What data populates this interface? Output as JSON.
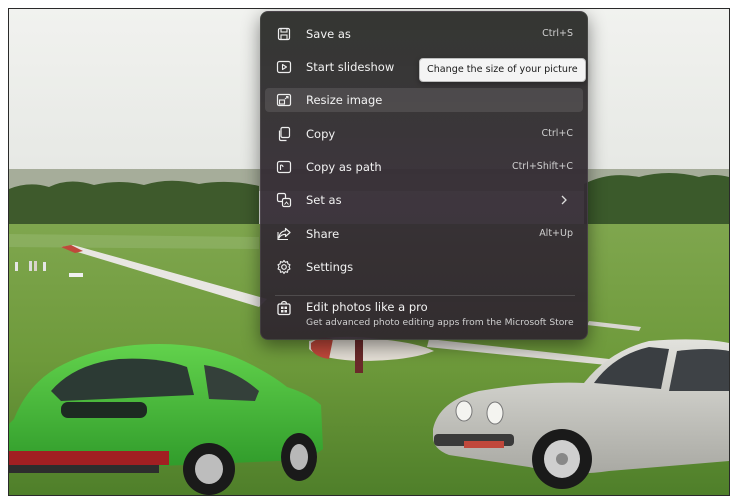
{
  "context_menu": {
    "items": [
      {
        "label": "Save as",
        "shortcut": "Ctrl+S",
        "icon": "save-icon"
      },
      {
        "label": "Start slideshow",
        "shortcut": "",
        "icon": "slideshow-icon"
      },
      {
        "label": "Resize image",
        "shortcut": "",
        "icon": "resize-icon"
      },
      {
        "label": "Copy",
        "shortcut": "Ctrl+C",
        "icon": "copy-icon"
      },
      {
        "label": "Copy as path",
        "shortcut": "Ctrl+Shift+C",
        "icon": "copy-path-icon"
      },
      {
        "label": "Set as",
        "shortcut": "",
        "icon": "set-as-icon",
        "has_submenu": true
      },
      {
        "label": "Share",
        "shortcut": "Alt+Up",
        "icon": "share-icon"
      },
      {
        "label": "Settings",
        "shortcut": "",
        "icon": "settings-icon"
      }
    ],
    "promo": {
      "title": "Edit photos like a pro",
      "subtitle": "Get advanced photo editing apps from the Microsoft Store",
      "icon": "store-icon"
    },
    "highlighted_item": "Resize image"
  },
  "tooltip": {
    "text": "Change the size of your picture"
  },
  "photo": {
    "subject": "two-vintage-cars-on-airfield"
  },
  "colors": {
    "menu_background": "#2f2f2d",
    "menu_text": "#f3f3f3",
    "tooltip_background": "#f4f4f4",
    "green_car": "#4cc23c",
    "silver_car": "#c9c9c4",
    "grass": "#6f9a3c"
  }
}
